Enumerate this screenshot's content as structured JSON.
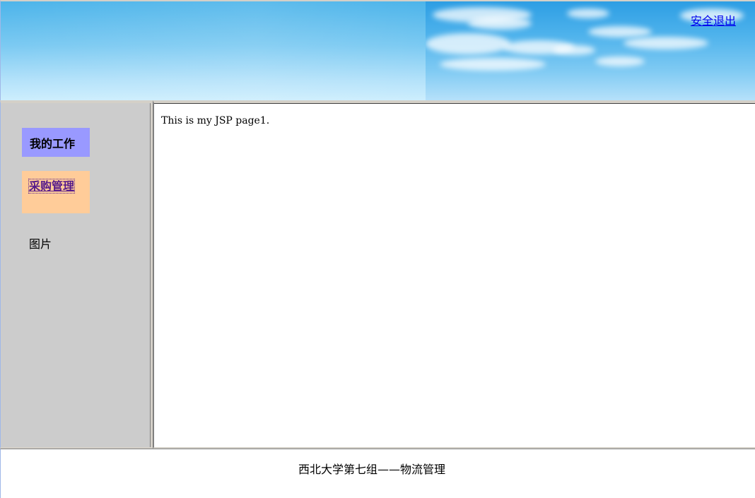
{
  "header": {
    "logout_label": "安全退出"
  },
  "sidebar": {
    "items": [
      {
        "label": "我的工作",
        "color": "#9999ff",
        "link": false
      },
      {
        "label": "采购管理",
        "color": "#ffcc99",
        "link": true
      },
      {
        "label": "图片",
        "color": "#cccccc",
        "link": false
      }
    ]
  },
  "main": {
    "text": "This is my JSP page1."
  },
  "footer": {
    "text": "西北大学第七组——物流管理"
  },
  "colors": {
    "sidebar_bg": "#cccccc",
    "link": "#0000ee",
    "visited_link": "#551a8b"
  }
}
